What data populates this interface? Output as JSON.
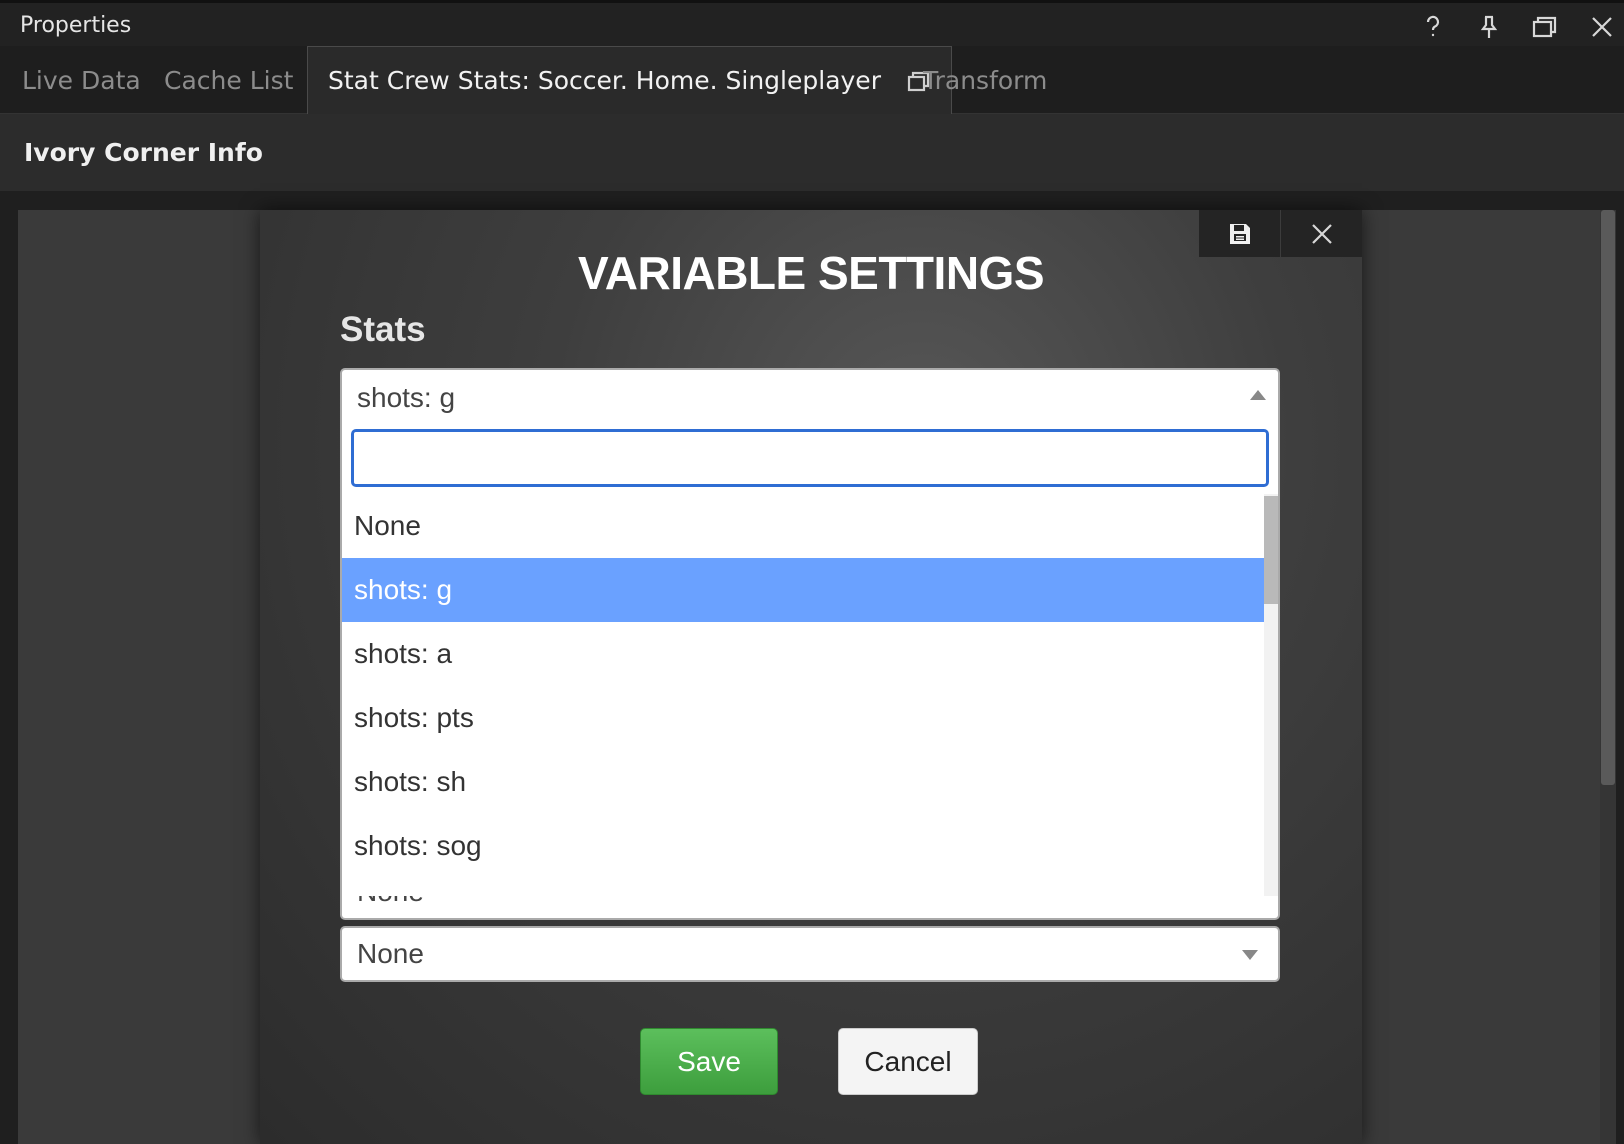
{
  "window": {
    "title": "Properties",
    "controls": [
      "help-icon",
      "pin-icon",
      "restore-icon",
      "close-icon"
    ]
  },
  "tabs": [
    {
      "label": "Live Data",
      "active": false
    },
    {
      "label": "Cache List",
      "active": false
    },
    {
      "label": "Stat Crew Stats: Soccer. Home. Singleplayer",
      "active": true
    },
    {
      "label": "Transform",
      "active": false
    }
  ],
  "section": {
    "title": "Ivory Corner Info"
  },
  "modal": {
    "heading": "VARIABLE SETTINGS",
    "toolbar_icons": [
      "save-icon",
      "close-icon"
    ],
    "stats_label": "Stats",
    "stats_select": {
      "value": "shots: g",
      "search_value": "",
      "options": [
        "None",
        "shots: g",
        "shots: a",
        "shots: pts",
        "shots: sh",
        "shots: sog"
      ],
      "selected_index": 1
    },
    "second_select": {
      "value": "None"
    },
    "third_select": {
      "value": "None"
    },
    "save_label": "Save",
    "cancel_label": "Cancel"
  },
  "colors": {
    "selected_option": "#6aa1ff",
    "save_button": "#4cae4c",
    "search_focus": "#2f6dd3"
  }
}
